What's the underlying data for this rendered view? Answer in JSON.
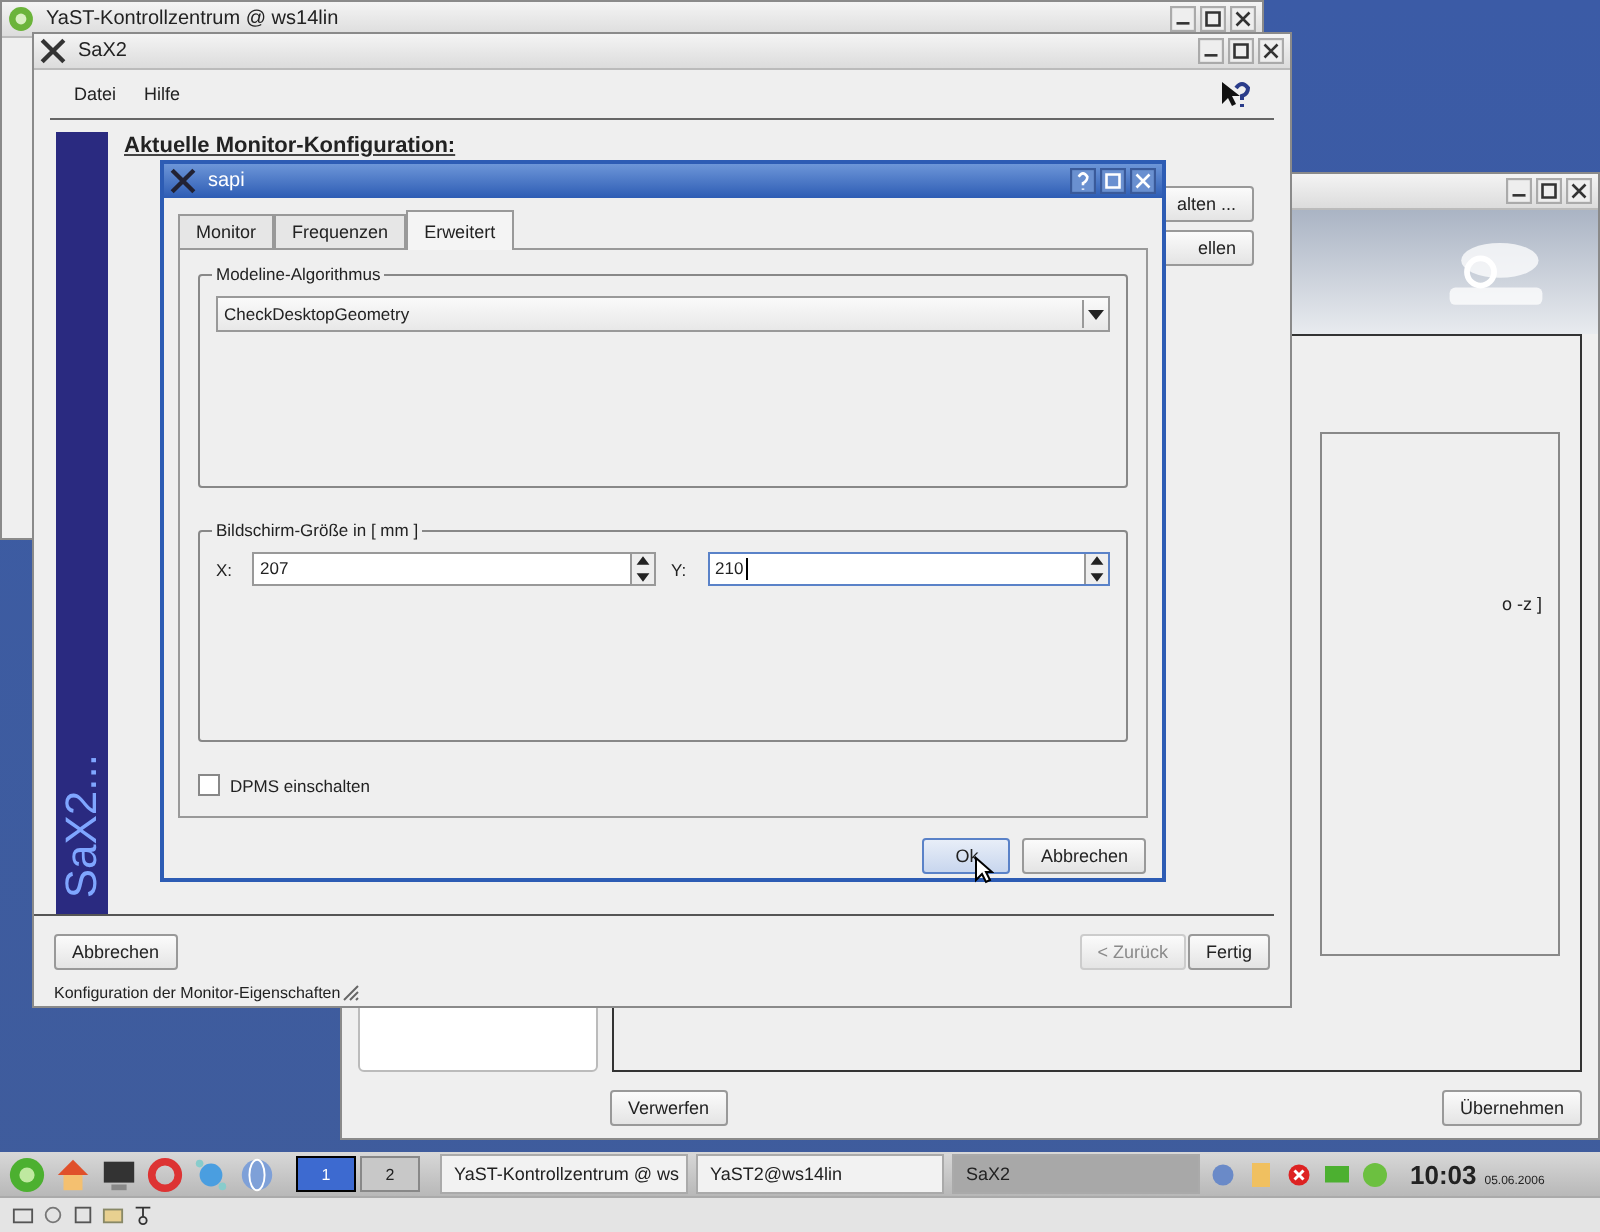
{
  "yast_window": {
    "title": "YaST-Kontrollzentrum @ ws14lin"
  },
  "yast2_window": {
    "partial_text": "o -z ]",
    "buttons": [
      "Verwerfen",
      "Übernehmen"
    ]
  },
  "sax2_window": {
    "title": "SaX2",
    "menu": [
      "Datei",
      "Hilfe"
    ],
    "heading": "Aktuelle Monitor-Konfiguration:",
    "banner_text": "SaX2...",
    "side_buttons": [
      "alten ...",
      "ellen"
    ],
    "buttons": [
      {
        "label": "Abbrechen",
        "disabled": false
      },
      {
        "label": "< Zurück",
        "disabled": true
      },
      {
        "label": "Fertig",
        "disabled": false
      }
    ],
    "status": "Konfiguration der Monitor-Eigenschaften"
  },
  "dialog": {
    "title": "sapi",
    "tabs": [
      {
        "label": "Monitor",
        "selected": false
      },
      {
        "label": "Frequenzen",
        "selected": false
      },
      {
        "label": "Erweitert",
        "selected": true
      }
    ],
    "modeline_group": {
      "title": "Modeline-Algorithmus",
      "value": "CheckDesktopGeometry"
    },
    "size_group": {
      "title": "Bildschirm-Größe in [ mm ]",
      "x_label": "X:",
      "x_value": "207",
      "y_label": "Y:",
      "y_value": "210"
    },
    "dpms": {
      "label": "DPMS einschalten",
      "checked": false
    },
    "buttons": [
      "Ok",
      "Abbrechen"
    ]
  },
  "taskbar": {
    "pager": [
      {
        "label": "1",
        "selected": true
      },
      {
        "label": "2",
        "selected": false
      }
    ],
    "tasks": [
      {
        "label": "YaST-Kontrollzentrum @ ws",
        "selected": false
      },
      {
        "label": "YaST2@ws14lin",
        "selected": false
      },
      {
        "label": "SaX2",
        "selected": true
      }
    ],
    "clock": "10:03",
    "date": "05.06.2006"
  }
}
